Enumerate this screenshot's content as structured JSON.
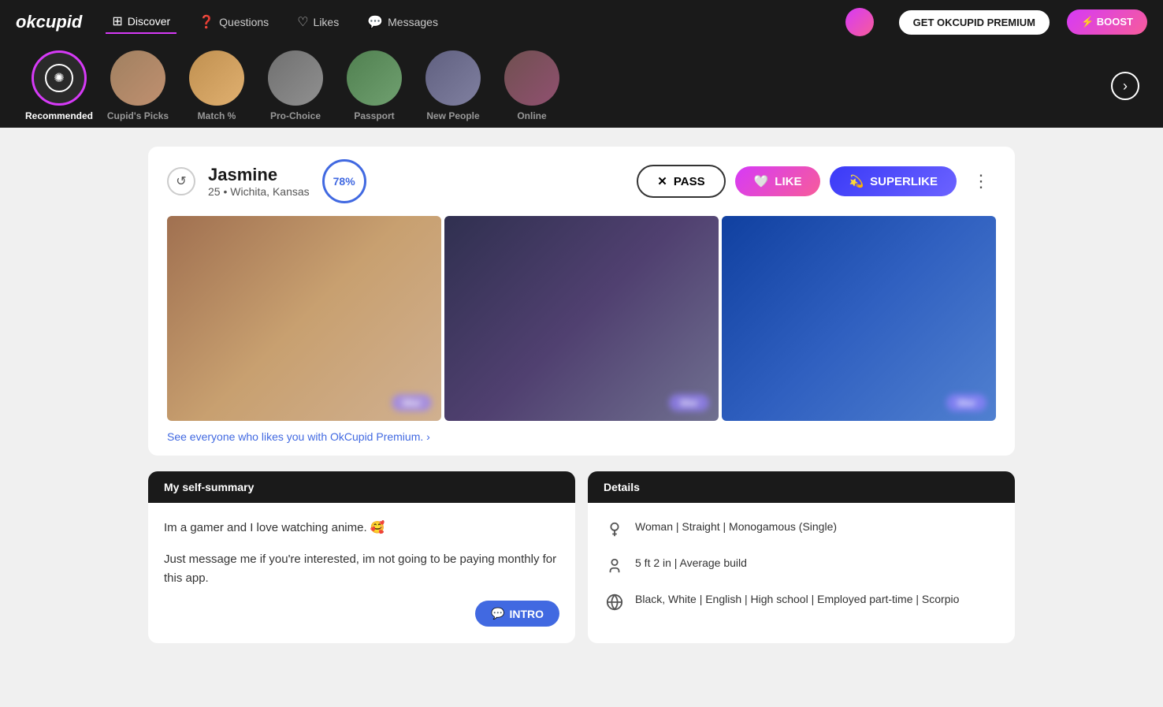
{
  "app": {
    "logo": "okcupid",
    "premium_btn": "GET OKCUPID PREMIUM",
    "boost_btn": "⚡ BOOST"
  },
  "nav": {
    "items": [
      {
        "id": "discover",
        "label": "Discover",
        "active": true,
        "icon": "⊞"
      },
      {
        "id": "questions",
        "label": "Questions",
        "active": false,
        "icon": "?"
      },
      {
        "id": "likes",
        "label": "Likes",
        "active": false,
        "icon": "♡"
      },
      {
        "id": "messages",
        "label": "Messages",
        "active": false,
        "icon": "💬"
      }
    ]
  },
  "categories": [
    {
      "id": "recommended",
      "label": "Recommended",
      "active": true,
      "type": "icon"
    },
    {
      "id": "cupids-picks",
      "label": "Cupid's Picks",
      "active": false,
      "type": "avatar"
    },
    {
      "id": "match",
      "label": "Match %",
      "active": false,
      "type": "avatar"
    },
    {
      "id": "pro-choice",
      "label": "Pro-Choice",
      "active": false,
      "type": "avatar"
    },
    {
      "id": "passport",
      "label": "Passport",
      "active": false,
      "type": "avatar"
    },
    {
      "id": "new-people",
      "label": "New People",
      "active": false,
      "type": "avatar"
    },
    {
      "id": "online",
      "label": "Online",
      "active": false,
      "type": "avatar"
    }
  ],
  "profile": {
    "name": "Jasmine",
    "age": "25",
    "location": "Wichita, Kansas",
    "match_pct": "78%",
    "pass_label": "PASS",
    "like_label": "LIKE",
    "superlike_label": "SUPERLIKE",
    "see_likes_text": "See everyone who likes you with OkCupid Premium. ›",
    "self_summary_header": "My self-summary",
    "self_summary_p1": "Im a gamer and I love watching anime. 🥰",
    "self_summary_p2": "Just message me if you're interested, im not going to be paying monthly for this app.",
    "intro_btn": "INTRO",
    "details_header": "Details",
    "detail_1": "Woman | Straight | Monogamous (Single)",
    "detail_2": "5 ft 2 in | Average build",
    "detail_3": "Black, White | English | High school | Employed part-time | Scorpio"
  }
}
